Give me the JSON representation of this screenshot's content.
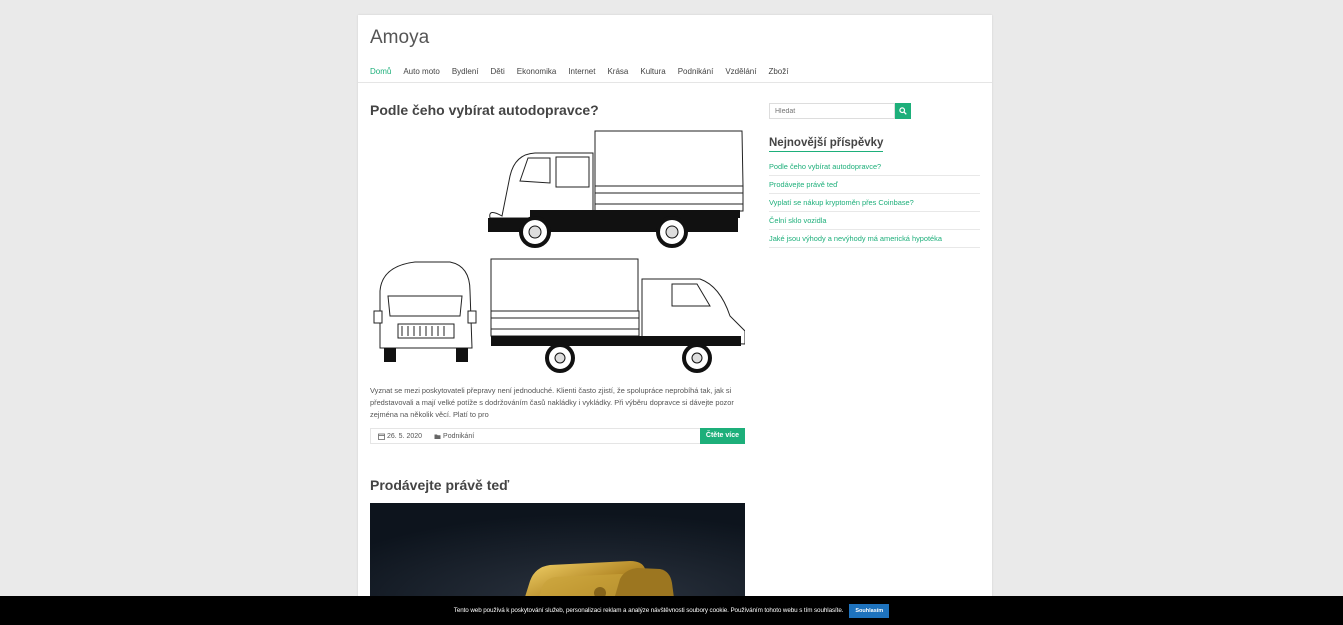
{
  "site": {
    "title": "Amoya"
  },
  "nav": {
    "items": [
      {
        "label": "Domů",
        "active": true
      },
      {
        "label": "Auto moto",
        "active": false
      },
      {
        "label": "Bydlení",
        "active": false
      },
      {
        "label": "Děti",
        "active": false
      },
      {
        "label": "Ekonomika",
        "active": false
      },
      {
        "label": "Internet",
        "active": false
      },
      {
        "label": "Krása",
        "active": false
      },
      {
        "label": "Kultura",
        "active": false
      },
      {
        "label": "Podnikání",
        "active": false
      },
      {
        "label": "Vzdělání",
        "active": false
      },
      {
        "label": "Zboží",
        "active": false
      }
    ]
  },
  "posts": [
    {
      "title": "Podle čeho vybírat autodopravce?",
      "excerpt": "Vyznat se mezi poskytovateli přepravy není jednoduché. Klienti často zjistí, že spolupráce neprobíhá tak, jak si představovali a mají velké potíže s dodržováním časů nakládky i vykládky. Při výběru dopravce si dávejte pozor zejména na několik věcí. Platí to pro",
      "date": "26. 5. 2020",
      "category": "Podnikání",
      "read_more": "Čtěte více",
      "image_icon": "truck-drawing"
    },
    {
      "title": "Prodávejte právě teď",
      "image_icon": "gold-bars-photo"
    }
  ],
  "sidebar": {
    "search_placeholder": "Hledat",
    "search_icon": "search-icon",
    "recent_title": "Nejnovější příspěvky",
    "recent_items": [
      "Podle čeho vybírat autodopravce?",
      "Prodávejte právě teď",
      "Vyplatí se nákup kryptoměn přes Coinbase?",
      "Čelní sklo vozidla",
      "Jaké jsou výhody a nevýhody má americká hypotéka"
    ]
  },
  "cookie": {
    "text": "Tento web používá k poskytování služeb, personalizaci reklam a analýze návštěvnosti soubory cookie. Používáním tohoto webu s tím souhlasíte.",
    "button": "Souhlasím"
  },
  "colors": {
    "accent": "#1daf7a",
    "cookie_button": "#1e73be",
    "background": "#eaeaea"
  }
}
